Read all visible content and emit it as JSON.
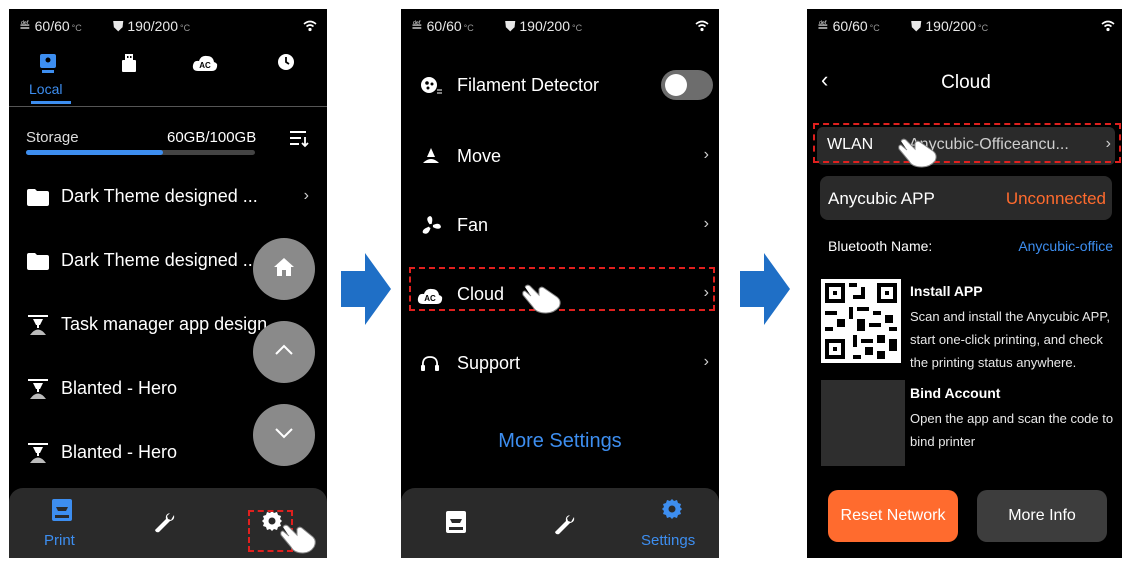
{
  "status": {
    "nozzle": "60/60",
    "bed": "190/200",
    "unit": "°C"
  },
  "screen1": {
    "tabs": [
      {
        "label": "Local",
        "icon": "storage-icon"
      },
      {
        "label": "",
        "icon": "usb-icon"
      },
      {
        "label": "",
        "icon": "cloud-ac-icon"
      },
      {
        "label": "",
        "icon": "clock-icon"
      }
    ],
    "storage_label": "Storage",
    "storage_value": "60GB/100GB",
    "storage_fraction": 0.6,
    "files": [
      {
        "name": "Dark Theme designed ...",
        "type": "folder"
      },
      {
        "name": "Dark Theme designed ...",
        "type": "folder"
      },
      {
        "name": "Task manager app design",
        "type": "model"
      },
      {
        "name": "Blanted - Hero",
        "type": "model"
      },
      {
        "name": "Blanted - Hero",
        "type": "model"
      }
    ],
    "bottom_tabs": [
      {
        "label": "Print"
      },
      {
        "label": ""
      },
      {
        "label": ""
      }
    ]
  },
  "screen2": {
    "items": [
      {
        "label": "Filament Detector",
        "icon": "filament-icon",
        "control": "toggle",
        "toggle_on": false
      },
      {
        "label": "Move",
        "icon": "move-icon"
      },
      {
        "label": "Fan",
        "icon": "fan-icon"
      },
      {
        "label": "Cloud",
        "icon": "cloud-ac-icon"
      },
      {
        "label": "Support",
        "icon": "support-icon"
      }
    ],
    "more_settings": "More Settings",
    "bottom_tabs": [
      {
        "label": ""
      },
      {
        "label": ""
      },
      {
        "label": "Settings"
      }
    ]
  },
  "screen3": {
    "title": "Cloud",
    "wlan_label": "WLAN",
    "wlan_value": "Anycubic-Officeancu...",
    "app_label": "Anycubic APP",
    "app_status": "Unconnected",
    "bt_label": "Bluetooth Name:",
    "bt_value": "Anycubic-office",
    "install_title": "Install APP",
    "install_text": "Scan and install the Anycubic APP, start one-click printing, and check the printing status anywhere.",
    "bind_title": "Bind Account",
    "bind_text": "Open the app and scan the code to bind printer",
    "reset_button": "Reset Network",
    "more_info_button": "More Info"
  },
  "colors": {
    "accent": "#3d8ef0",
    "orange": "#ff6b2e",
    "flow_arrow": "#1f6fc6",
    "highlight": "#e0201e"
  }
}
